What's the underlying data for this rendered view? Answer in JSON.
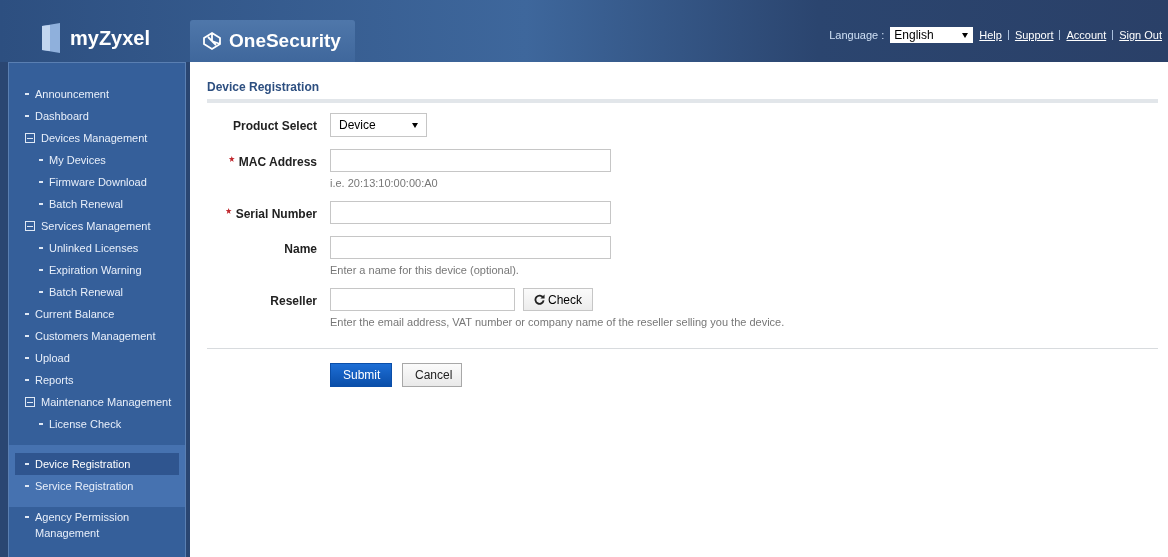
{
  "header": {
    "logo": "myZyxel",
    "product_tab": "OneSecurity",
    "language_label": "Language :",
    "language_value": "English",
    "links": [
      "Help",
      "Support",
      "Account",
      "Sign Out"
    ]
  },
  "sidebar": {
    "sections": [
      {
        "highlighted": false,
        "items": [
          {
            "label": "Announcement",
            "selected": false
          },
          {
            "label": "Dashboard",
            "selected": false
          },
          {
            "label": "Devices Management",
            "selected": false,
            "expanded": true,
            "children": [
              {
                "label": "My Devices",
                "selected": false
              },
              {
                "label": "Firmware Download",
                "selected": false
              },
              {
                "label": "Batch Renewal",
                "selected": false
              }
            ]
          },
          {
            "label": "Services Management",
            "selected": false,
            "expanded": true,
            "children": [
              {
                "label": "Unlinked Licenses",
                "selected": false
              },
              {
                "label": "Expiration Warning",
                "selected": false
              },
              {
                "label": "Batch Renewal",
                "selected": false
              }
            ]
          },
          {
            "label": "Current Balance",
            "selected": false
          },
          {
            "label": "Customers Management",
            "selected": false
          },
          {
            "label": "Upload",
            "selected": false
          },
          {
            "label": "Reports",
            "selected": false
          },
          {
            "label": "Maintenance Management",
            "selected": false,
            "expanded": true,
            "children": [
              {
                "label": "License Check",
                "selected": false
              }
            ]
          }
        ]
      },
      {
        "highlighted": true,
        "items": [
          {
            "label": "Device Registration",
            "selected": true
          },
          {
            "label": "Service Registration",
            "selected": false
          }
        ]
      },
      {
        "highlighted": false,
        "items": [
          {
            "label": "Agency Permission Management",
            "selected": false
          }
        ]
      }
    ]
  },
  "form": {
    "title": "Device Registration",
    "fields": [
      {
        "kind": "select",
        "label": "Product Select",
        "required": false,
        "value": "Device"
      },
      {
        "kind": "text",
        "label": "MAC Address",
        "required": true,
        "hint": "i.e. 20:13:10:00:00:A0"
      },
      {
        "kind": "text",
        "label": "Serial Number",
        "required": true
      },
      {
        "kind": "text",
        "label": "Name",
        "required": false,
        "hint": "Enter a name for this device (optional)."
      },
      {
        "kind": "check",
        "label": "Reseller",
        "required": false,
        "button": "Check",
        "hint": "Enter the email address, VAT number or company name of the reseller selling you the device."
      }
    ],
    "buttons": [
      {
        "label": "Submit",
        "kind": "primary"
      },
      {
        "label": "Cancel",
        "kind": "secondary"
      }
    ]
  }
}
